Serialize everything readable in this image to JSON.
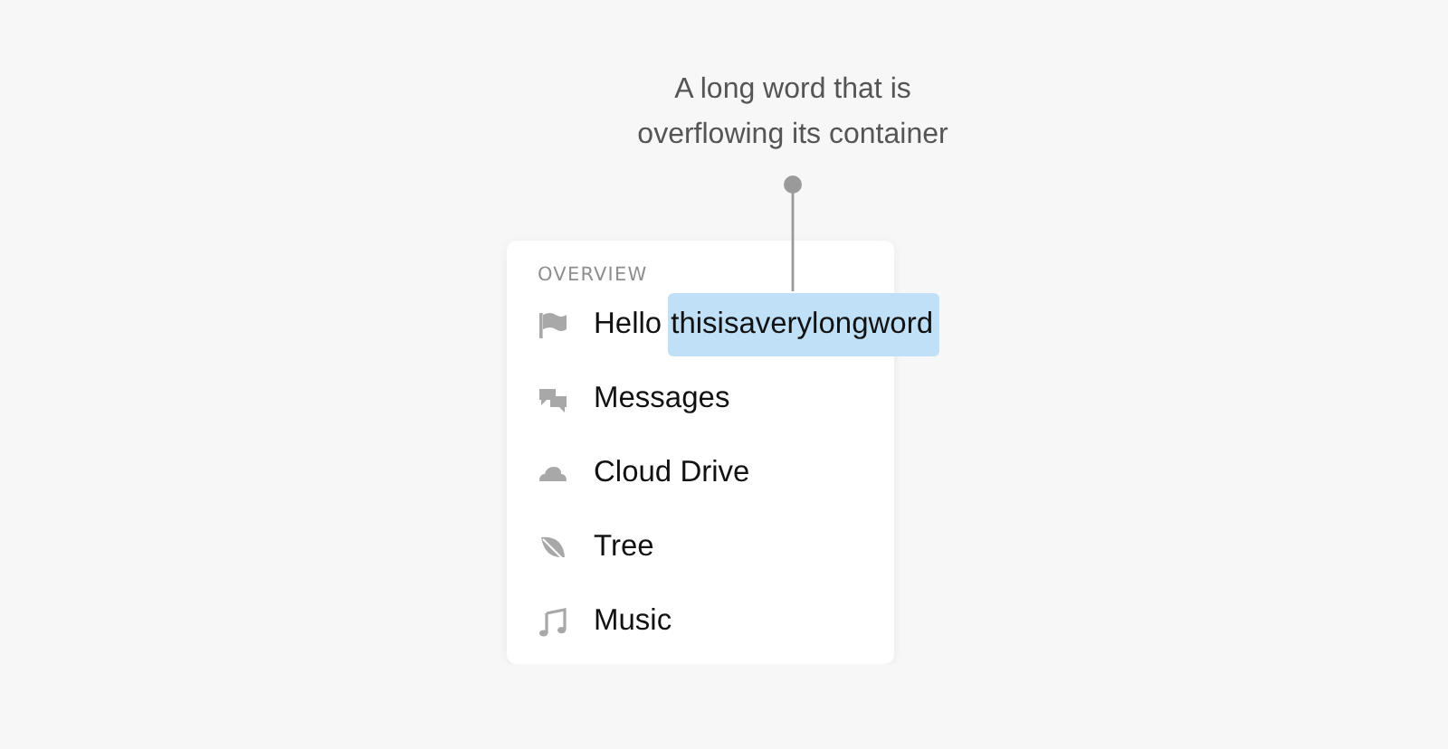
{
  "annotation": {
    "text": "A long word that is overflowing its container"
  },
  "menu": {
    "heading": "OVERVIEW",
    "items": [
      {
        "label": "Hello",
        "long_word": "thisisaverylongword",
        "highlighted": true
      },
      {
        "label": "Messages"
      },
      {
        "label": "Cloud Drive"
      },
      {
        "label": "Tree"
      },
      {
        "label": "Music"
      }
    ]
  }
}
